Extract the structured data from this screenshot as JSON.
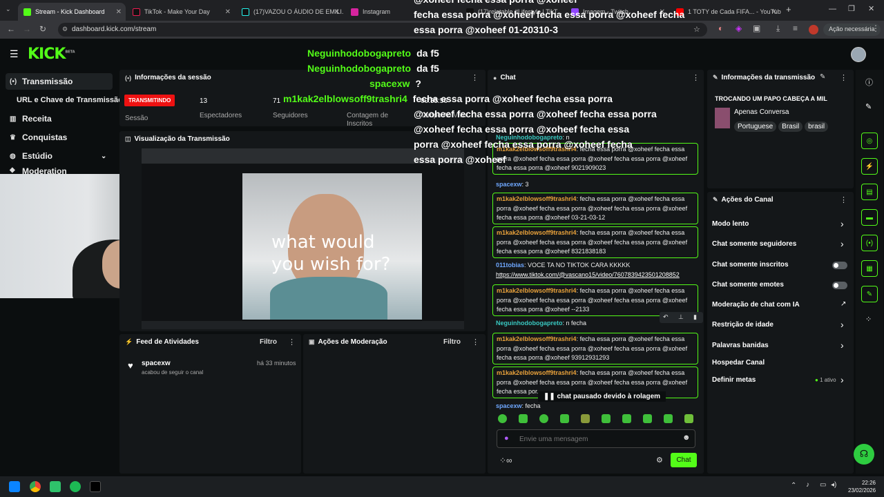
{
  "browser": {
    "tabs": [
      {
        "label": "Stream - Kick Dashboard",
        "active": true
      },
      {
        "label": "TikTok - Make Your Day"
      },
      {
        "label": "(17)VAZOU O ÁUDIO DE EMILI..."
      },
      {
        "label": "Instagram"
      },
      {
        "label": "(17)relatable #Lifestyle | TikT..."
      },
      {
        "label": "Imagem - Twitch"
      },
      {
        "label": "1 TOTY de Cada FIFA... - YouTube"
      }
    ],
    "url": "dashboard.kick.com/stream",
    "action_label": "Ação necessária"
  },
  "app": {
    "logo": "KICK",
    "logo_sup": "BETA"
  },
  "sidebar": {
    "items": [
      {
        "label": "Transmissão",
        "icon": "broadcast-icon"
      },
      {
        "label": "URL e Chave de Transmissão",
        "icon": ""
      },
      {
        "label": "Receita",
        "icon": "revenue-icon"
      },
      {
        "label": "Conquistas",
        "icon": "trophy-icon"
      },
      {
        "label": "Estúdio",
        "icon": "studio-icon"
      },
      {
        "label": "Moderation",
        "icon": "shield-icon"
      }
    ]
  },
  "session": {
    "title": "Informações da sessão",
    "badge": "TRANSMITINDO",
    "badge_label": "Sessão",
    "viewers": "13",
    "viewers_label": "Espectadores",
    "followers": "71",
    "followers_label": "Seguidores",
    "subs_label": "Contagem de Inscritos",
    "live_time": "00:35:56",
    "live_time_label": "Tempo Ao Vivo"
  },
  "preview": {
    "title": "Visualização da Transmissão",
    "caption_line1": "what would",
    "caption_line2": "you wish for?"
  },
  "feed": {
    "title": "Feed de Atividades",
    "filter": "Filtro",
    "items": [
      {
        "user": "spacexw",
        "time": "há 33 minutos",
        "text": "acabou de seguir o canal"
      }
    ]
  },
  "modactions": {
    "title": "Ações de Moderação",
    "filter": "Filtro"
  },
  "overlay": {
    "lines": [
      {
        "user": "",
        "text": "@xoheef fecha essa porra @xoheef"
      },
      {
        "user": "",
        "text": "fecha essa porra @xoheef fecha essa porra @xoheef fecha"
      },
      {
        "user": "",
        "text": "essa porra @xoheef 01-20310-3"
      },
      {
        "user": "Neguinhodobogapreto",
        "text": "da f5"
      },
      {
        "user": "Neguinhodobogapreto",
        "text": "da f5"
      },
      {
        "user": "spacexw",
        "text": "?"
      },
      {
        "user": "m1kak2elblowsoff9trashri4",
        "text": "fecha essa porra @xoheef fecha essa porra"
      },
      {
        "user": "",
        "text": "@xoheef fecha essa porra @xoheef fecha essa porra"
      },
      {
        "user": "",
        "text": "@xoheef fecha essa porra @xoheef fecha essa"
      },
      {
        "user": "",
        "text": "porra @xoheef fecha essa porra @xoheef fecha"
      },
      {
        "user": "",
        "text": "essa porra @xoheef"
      }
    ]
  },
  "chat": {
    "title": "Chat",
    "messages": [
      {
        "user": "Neguinhodobogapreto",
        "color": "t",
        "text": "n",
        "hl": false
      },
      {
        "user": "m1kak2elblowsoff9trashri4",
        "color": "o",
        "text": "fecha essa porra @xoheef fecha essa porra @xoheef fecha essa porra @xoheef fecha essa porra @xoheef fecha essa porra @xoheef 9021909023",
        "hl": true
      },
      {
        "user": "spacexw",
        "color": "b",
        "text": "3",
        "hl": false
      },
      {
        "user": "m1kak2elblowsoff9trashri4",
        "color": "o",
        "text": "fecha essa porra @xoheef fecha essa porra @xoheef fecha essa porra @xoheef fecha essa porra @xoheef fecha essa porra @xoheef 03-21-03-12",
        "hl": true
      },
      {
        "user": "m1kak2elblowsoff9trashri4",
        "color": "o",
        "text": "fecha essa porra @xoheef fecha essa porra @xoheef fecha essa porra @xoheef fecha essa porra @xoheef fecha essa porra @xoheef 8321838183",
        "hl": true
      },
      {
        "user": "011tobias",
        "color": "b",
        "text": "VOCE TA NO TIKTOK CARA KKKKK",
        "link": "https://www.tiktok.com/@vascano15/video/7607839423501208852",
        "hl": false
      },
      {
        "user": "m1kak2elblowsoff9trashri4",
        "color": "o",
        "text": "fecha essa porra @xoheef fecha essa porra @xoheef fecha essa porra @xoheef fecha essa porra @xoheef fecha essa porra @xoheef --2133",
        "hl": true
      },
      {
        "user": "Neguinhodobogapreto",
        "color": "t",
        "text": "n fecha",
        "hl": false
      },
      {
        "user": "m1kak2elblowsoff9trashri4",
        "color": "o",
        "text": "fecha essa porra @xoheef fecha essa porra @xoheef fecha essa porra @xoheef fecha essa porra @xoheef fecha essa porra @xoheef 93912931293",
        "hl": true
      },
      {
        "user": "m1kak2elblowsoff9trashri4",
        "color": "o",
        "text": "fecha essa porra @xoheef fecha essa porra @xoheef fecha essa porra @xoheef fecha essa porra @xoheef fecha essa por...",
        "hl": true
      },
      {
        "user": "spacexw",
        "color": "b",
        "text": "fecha",
        "hl": false
      }
    ],
    "paused": "chat pausado devido à rolagem",
    "input_placeholder": "Envie uma mensagem",
    "send": "Chat"
  },
  "stream_info": {
    "title": "Informações da transmissão",
    "stream_title": "TROCANDO UM PAPO CABEÇA A MIL",
    "category": "Apenas Conversa",
    "tags": [
      "Portuguese",
      "Brasil",
      "brasil"
    ]
  },
  "channel_actions": {
    "title": "Ações do Canal",
    "items": [
      {
        "label": "Modo lento",
        "kind": "chevron"
      },
      {
        "label": "Chat somente seguidores",
        "kind": "chevron"
      },
      {
        "label": "Chat somente inscritos",
        "kind": "toggle"
      },
      {
        "label": "Chat somente emotes",
        "kind": "toggle"
      },
      {
        "label": "Moderação de chat com IA",
        "kind": "external"
      },
      {
        "label": "Restrição de idade",
        "kind": "chevron"
      },
      {
        "label": "Palavras banidas",
        "kind": "chevron"
      },
      {
        "label": "Hospedar Canal",
        "kind": "none"
      },
      {
        "label": "Definir metas",
        "kind": "chevron",
        "extra": "1 ativo"
      }
    ]
  },
  "taskbar": {
    "time": "22:26",
    "date": "23/02/2026"
  },
  "colors": {
    "accent": "#53fc18",
    "live": "#e11111",
    "panel": "#141719"
  }
}
